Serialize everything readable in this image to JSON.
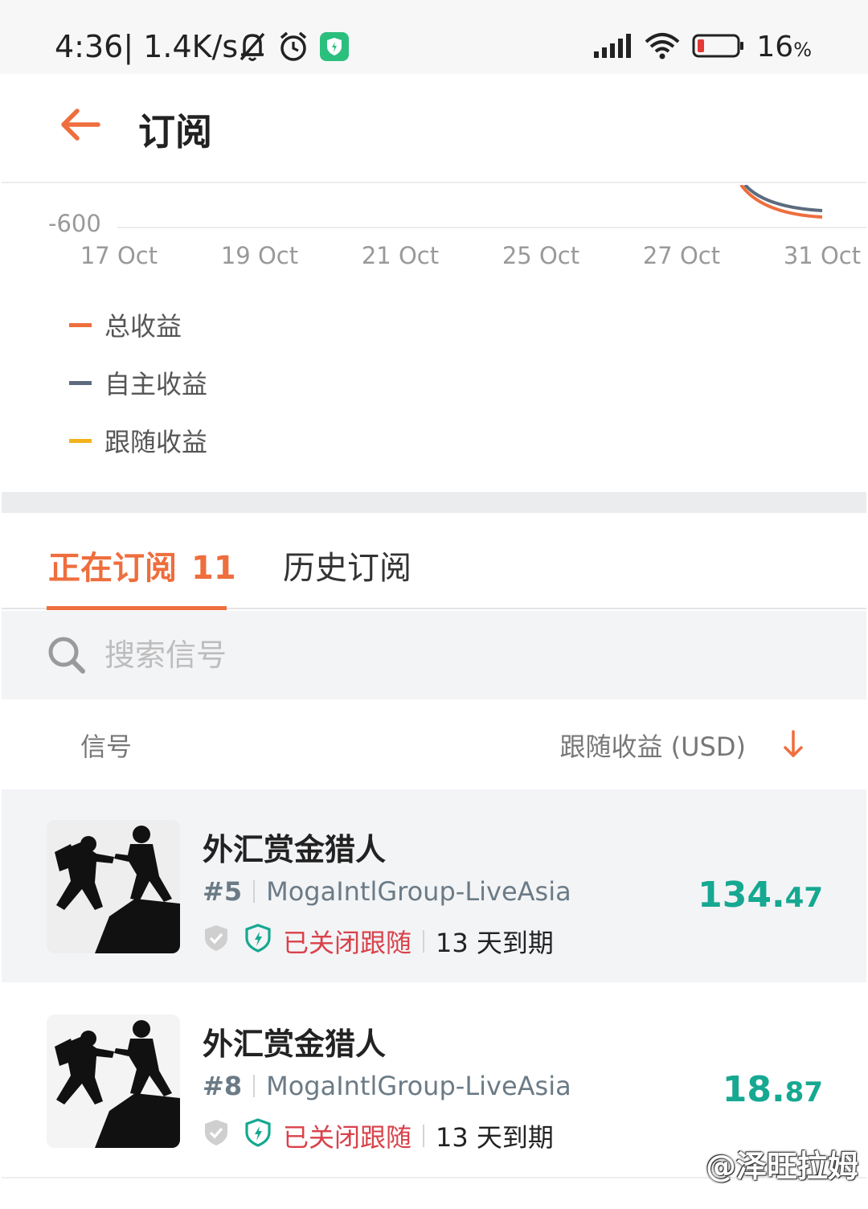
{
  "status_bar": {
    "time": "4:36",
    "speed": "| 1.4K/s",
    "battery_value": "16",
    "battery_unit": "%"
  },
  "header": {
    "title": "订阅",
    "back_icon": "arrow-left-icon"
  },
  "chart": {
    "y_tick": "-600",
    "x_ticks": [
      "17 Oct",
      "19 Oct",
      "21 Oct",
      "25 Oct",
      "27 Oct",
      "31 Oct"
    ],
    "legend": [
      {
        "label": "总收益",
        "color": "#ee6e3d"
      },
      {
        "label": "自主收益",
        "color": "#5c6b7e"
      },
      {
        "label": "跟随收益",
        "color": "#f2b31c"
      }
    ]
  },
  "tabs": {
    "active_label": "正在订阅",
    "active_count": "11",
    "inactive_label": "历史订阅"
  },
  "search": {
    "placeholder": "搜索信号"
  },
  "columns": {
    "signal": "信号",
    "profit": "跟随收益 (USD)"
  },
  "rows": [
    {
      "name": "外汇赏金猎人",
      "rank": "#5",
      "server": "MogaIntlGroup-LiveAsia",
      "status": "已关闭跟随",
      "expiry": "13 天到期",
      "profit_int": "134.",
      "profit_dec": "47"
    },
    {
      "name": "外汇赏金猎人",
      "rank": "#8",
      "server": "MogaIntlGroup-LiveAsia",
      "status": "已关闭跟随",
      "expiry": "13 天到期",
      "profit_int": "18.",
      "profit_dec": "87"
    }
  ],
  "watermark": "@泽旺拉姆",
  "colors": {
    "accent": "#ee6e3d",
    "profit": "#16a891",
    "closed": "#d9424b"
  }
}
